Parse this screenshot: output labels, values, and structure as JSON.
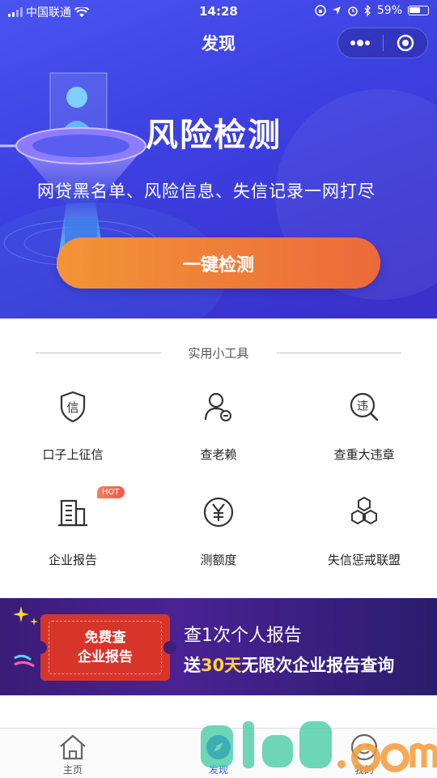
{
  "status_bar": {
    "carrier": "中国联通",
    "time": "14:28",
    "battery": "59%"
  },
  "nav": {
    "title": "发现"
  },
  "hero": {
    "title": "风险检测",
    "subtitle": "网贷黑名单、风险信息、失信记录一网打尽",
    "button_label": "一键检测"
  },
  "tools_section": {
    "label": "实用小工具",
    "items": [
      {
        "label": "口子上征信",
        "icon": "credit-shield-icon"
      },
      {
        "label": "查老赖",
        "icon": "user-minus-icon"
      },
      {
        "label": "查重大违章",
        "icon": "violation-search-icon"
      },
      {
        "label": "企业报告",
        "icon": "building-icon",
        "badge": "HOT"
      },
      {
        "label": "测额度",
        "icon": "yuan-icon"
      },
      {
        "label": "失信惩戒联盟",
        "icon": "hexagon-cluster-icon"
      }
    ]
  },
  "banner": {
    "ticket_line1": "免费查",
    "ticket_line2": "企业报告",
    "title": "查1次个人报告",
    "sub_prefix": "送",
    "sub_highlight": "30天",
    "sub_suffix": "无限次企业报告查询"
  },
  "tabbar": {
    "items": [
      {
        "label": "主页",
        "icon": "home-icon"
      },
      {
        "label": "发现",
        "icon": "compass-icon",
        "active": true
      },
      {
        "label": "我的",
        "icon": "profile-icon"
      }
    ]
  },
  "colors": {
    "hero_bg": "#4a54f0",
    "button_orange": "#ec6a3a",
    "accent_blue": "#3f5bf0",
    "banner_bg": "#4a2294",
    "highlight_yellow": "#ffd43a"
  }
}
